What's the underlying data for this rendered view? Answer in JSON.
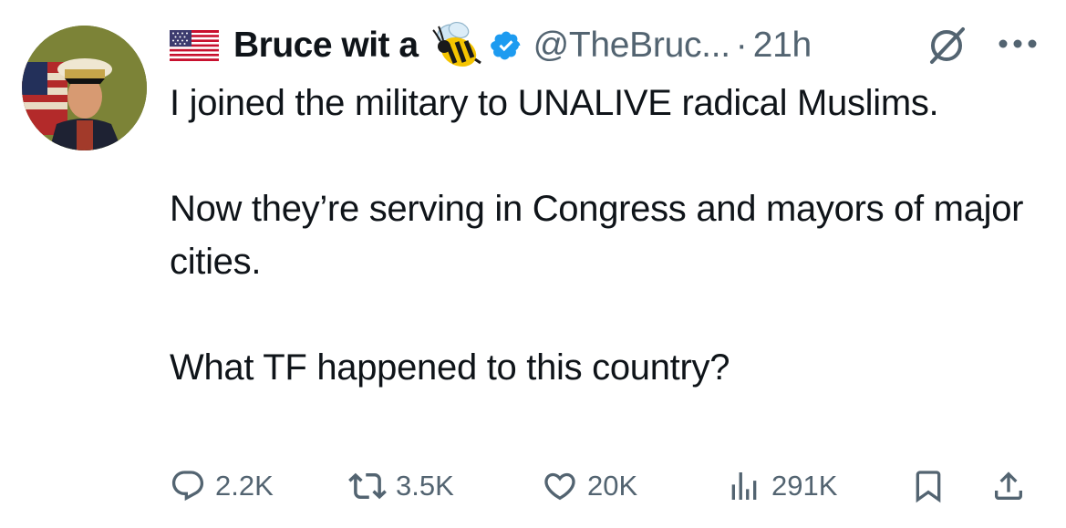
{
  "tweet": {
    "display_name": "Bruce wit a",
    "handle": "@TheBruc...",
    "separator": "·",
    "time": "21h",
    "paragraphs": [
      "I joined the military to UNALIVE radical Muslims.",
      "Now they’re serving in Congress and mayors of major cities.",
      "What TF happened to this country?"
    ]
  },
  "icons": {
    "flag": "us-flag-icon",
    "bee": "bee-emoji-icon",
    "verified": "verified-badge-icon",
    "grok": "grok-icon",
    "more": "more-options-icon"
  },
  "actions": {
    "replies": "2.2K",
    "reposts": "3.5K",
    "likes": "20K",
    "views": "291K"
  },
  "colors": {
    "text": "#0f1419",
    "secondary": "#536471",
    "verified": "#1d9bf0"
  }
}
